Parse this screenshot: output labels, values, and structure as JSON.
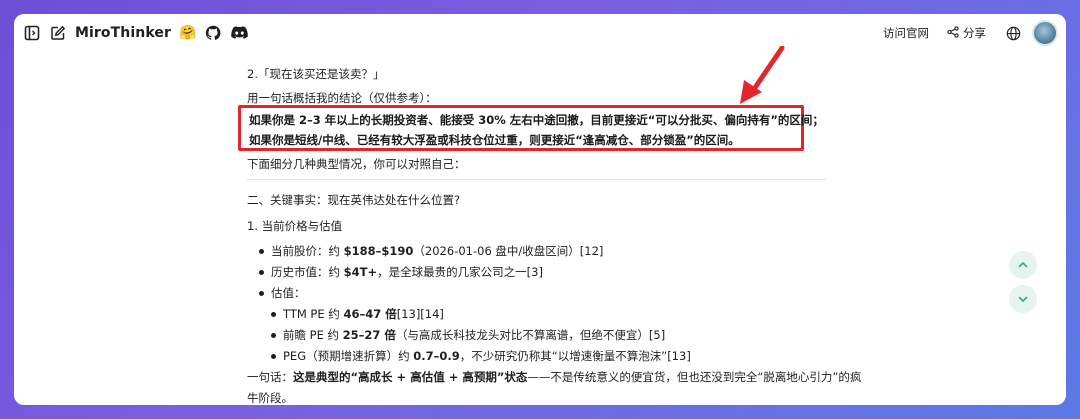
{
  "header": {
    "brand": "MiroThinker",
    "emoji": "🤗",
    "visit_site": "访问官网",
    "share": "分享"
  },
  "content": {
    "q2_heading": "2.「现在该买还是该卖？」",
    "summary_intro": "用一句话概括我的结论（仅供参考）：",
    "highlight_line1": "如果你是 2–3 年以上的长期投资者、能接受 30% 左右中途回撤，目前更接近“可以分批买、偏向持有”的区间；",
    "highlight_line2": "如果你是短线/中线、已经有较大浮盈或科技仓位过重，则更接近“逢高减仓、部分锁盈”的区间。",
    "partial_line": "下面细分几种典型情况，你可以对照自己：",
    "section2_heading": "二、关键事实：现在英伟达处在什么位置?",
    "sub1_heading": "1. 当前价格与估值",
    "bullets": {
      "price_prefix": "当前股价：约 ",
      "price_bold": "$188–$190",
      "price_suffix": "（2026-01-06 盘中/收盘区间）[12]",
      "mcap_prefix": "历史市值：约 ",
      "mcap_bold": "$4T+",
      "mcap_suffix": "，是全球最贵的几家公司之一[3]",
      "valuation_label": "估值："
    },
    "sub_bullets": {
      "ttm_prefix": "TTM PE 约 ",
      "ttm_bold": "46–47 倍",
      "ttm_suffix": "[13][14]",
      "fwd_prefix": "前瞻 PE 约 ",
      "fwd_bold": "25–27 倍",
      "fwd_suffix": "（与高成长科技龙头对比不算离谱，但绝不便宜）[5]",
      "peg_prefix": "PEG（预期增速折算）约 ",
      "peg_bold": "0.7–0.9",
      "peg_suffix": "，不少研究仍称其“以增速衡量不算泡沫”[13]"
    },
    "conclusion_prefix": "一句话：",
    "conclusion_bold": "这是典型的“高成长 + 高估值 + 高预期”状态",
    "conclusion_suffix": "——不是传统意义的便宜货，但也还没到完全“脱离地心引力”的疯",
    "conclusion_line2": "牛阶段。"
  },
  "colors": {
    "highlight_border": "#e2262b",
    "arrow": "#e2262b",
    "scroll_button_bg": "#e6f4f0",
    "scroll_icon": "#3aa88a"
  },
  "icons": [
    "sidebar-toggle-icon",
    "edit-icon",
    "github-icon",
    "discord-icon",
    "share-icon",
    "globe-icon",
    "chevron-up-icon",
    "chevron-down-icon"
  ]
}
